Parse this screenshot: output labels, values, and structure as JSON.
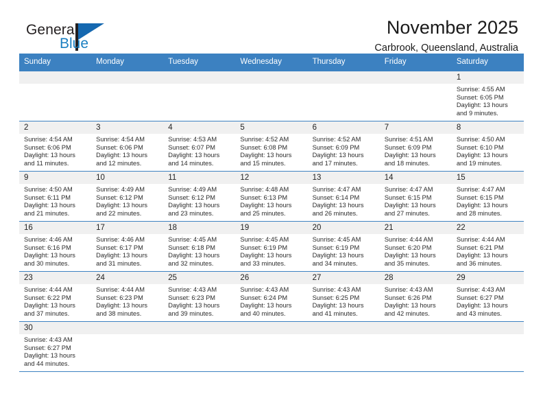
{
  "brand": {
    "name_top": "General",
    "name_bottom": "Blue",
    "accent_color": "#1a7fc1",
    "triangle_color": "#1568b0"
  },
  "header": {
    "month_title": "November 2025",
    "location": "Carbrook, Queensland, Australia"
  },
  "theme": {
    "header_blue": "#3c81c1",
    "daynum_bg": "#f0f0f0",
    "text": "#1a1a1a"
  },
  "weekday_headers": [
    "Sunday",
    "Monday",
    "Tuesday",
    "Wednesday",
    "Thursday",
    "Friday",
    "Saturday"
  ],
  "weeks": [
    [
      {
        "day": "",
        "sunrise": "",
        "sunset": "",
        "daylight_line1": "",
        "daylight_line2": ""
      },
      {
        "day": "",
        "sunrise": "",
        "sunset": "",
        "daylight_line1": "",
        "daylight_line2": ""
      },
      {
        "day": "",
        "sunrise": "",
        "sunset": "",
        "daylight_line1": "",
        "daylight_line2": ""
      },
      {
        "day": "",
        "sunrise": "",
        "sunset": "",
        "daylight_line1": "",
        "daylight_line2": ""
      },
      {
        "day": "",
        "sunrise": "",
        "sunset": "",
        "daylight_line1": "",
        "daylight_line2": ""
      },
      {
        "day": "",
        "sunrise": "",
        "sunset": "",
        "daylight_line1": "",
        "daylight_line2": ""
      },
      {
        "day": "1",
        "sunrise": "Sunrise: 4:55 AM",
        "sunset": "Sunset: 6:05 PM",
        "daylight_line1": "Daylight: 13 hours",
        "daylight_line2": "and 9 minutes."
      }
    ],
    [
      {
        "day": "2",
        "sunrise": "Sunrise: 4:54 AM",
        "sunset": "Sunset: 6:06 PM",
        "daylight_line1": "Daylight: 13 hours",
        "daylight_line2": "and 11 minutes."
      },
      {
        "day": "3",
        "sunrise": "Sunrise: 4:54 AM",
        "sunset": "Sunset: 6:06 PM",
        "daylight_line1": "Daylight: 13 hours",
        "daylight_line2": "and 12 minutes."
      },
      {
        "day": "4",
        "sunrise": "Sunrise: 4:53 AM",
        "sunset": "Sunset: 6:07 PM",
        "daylight_line1": "Daylight: 13 hours",
        "daylight_line2": "and 14 minutes."
      },
      {
        "day": "5",
        "sunrise": "Sunrise: 4:52 AM",
        "sunset": "Sunset: 6:08 PM",
        "daylight_line1": "Daylight: 13 hours",
        "daylight_line2": "and 15 minutes."
      },
      {
        "day": "6",
        "sunrise": "Sunrise: 4:52 AM",
        "sunset": "Sunset: 6:09 PM",
        "daylight_line1": "Daylight: 13 hours",
        "daylight_line2": "and 17 minutes."
      },
      {
        "day": "7",
        "sunrise": "Sunrise: 4:51 AM",
        "sunset": "Sunset: 6:09 PM",
        "daylight_line1": "Daylight: 13 hours",
        "daylight_line2": "and 18 minutes."
      },
      {
        "day": "8",
        "sunrise": "Sunrise: 4:50 AM",
        "sunset": "Sunset: 6:10 PM",
        "daylight_line1": "Daylight: 13 hours",
        "daylight_line2": "and 19 minutes."
      }
    ],
    [
      {
        "day": "9",
        "sunrise": "Sunrise: 4:50 AM",
        "sunset": "Sunset: 6:11 PM",
        "daylight_line1": "Daylight: 13 hours",
        "daylight_line2": "and 21 minutes."
      },
      {
        "day": "10",
        "sunrise": "Sunrise: 4:49 AM",
        "sunset": "Sunset: 6:12 PM",
        "daylight_line1": "Daylight: 13 hours",
        "daylight_line2": "and 22 minutes."
      },
      {
        "day": "11",
        "sunrise": "Sunrise: 4:49 AM",
        "sunset": "Sunset: 6:12 PM",
        "daylight_line1": "Daylight: 13 hours",
        "daylight_line2": "and 23 minutes."
      },
      {
        "day": "12",
        "sunrise": "Sunrise: 4:48 AM",
        "sunset": "Sunset: 6:13 PM",
        "daylight_line1": "Daylight: 13 hours",
        "daylight_line2": "and 25 minutes."
      },
      {
        "day": "13",
        "sunrise": "Sunrise: 4:47 AM",
        "sunset": "Sunset: 6:14 PM",
        "daylight_line1": "Daylight: 13 hours",
        "daylight_line2": "and 26 minutes."
      },
      {
        "day": "14",
        "sunrise": "Sunrise: 4:47 AM",
        "sunset": "Sunset: 6:15 PM",
        "daylight_line1": "Daylight: 13 hours",
        "daylight_line2": "and 27 minutes."
      },
      {
        "day": "15",
        "sunrise": "Sunrise: 4:47 AM",
        "sunset": "Sunset: 6:15 PM",
        "daylight_line1": "Daylight: 13 hours",
        "daylight_line2": "and 28 minutes."
      }
    ],
    [
      {
        "day": "16",
        "sunrise": "Sunrise: 4:46 AM",
        "sunset": "Sunset: 6:16 PM",
        "daylight_line1": "Daylight: 13 hours",
        "daylight_line2": "and 30 minutes."
      },
      {
        "day": "17",
        "sunrise": "Sunrise: 4:46 AM",
        "sunset": "Sunset: 6:17 PM",
        "daylight_line1": "Daylight: 13 hours",
        "daylight_line2": "and 31 minutes."
      },
      {
        "day": "18",
        "sunrise": "Sunrise: 4:45 AM",
        "sunset": "Sunset: 6:18 PM",
        "daylight_line1": "Daylight: 13 hours",
        "daylight_line2": "and 32 minutes."
      },
      {
        "day": "19",
        "sunrise": "Sunrise: 4:45 AM",
        "sunset": "Sunset: 6:19 PM",
        "daylight_line1": "Daylight: 13 hours",
        "daylight_line2": "and 33 minutes."
      },
      {
        "day": "20",
        "sunrise": "Sunrise: 4:45 AM",
        "sunset": "Sunset: 6:19 PM",
        "daylight_line1": "Daylight: 13 hours",
        "daylight_line2": "and 34 minutes."
      },
      {
        "day": "21",
        "sunrise": "Sunrise: 4:44 AM",
        "sunset": "Sunset: 6:20 PM",
        "daylight_line1": "Daylight: 13 hours",
        "daylight_line2": "and 35 minutes."
      },
      {
        "day": "22",
        "sunrise": "Sunrise: 4:44 AM",
        "sunset": "Sunset: 6:21 PM",
        "daylight_line1": "Daylight: 13 hours",
        "daylight_line2": "and 36 minutes."
      }
    ],
    [
      {
        "day": "23",
        "sunrise": "Sunrise: 4:44 AM",
        "sunset": "Sunset: 6:22 PM",
        "daylight_line1": "Daylight: 13 hours",
        "daylight_line2": "and 37 minutes."
      },
      {
        "day": "24",
        "sunrise": "Sunrise: 4:44 AM",
        "sunset": "Sunset: 6:23 PM",
        "daylight_line1": "Daylight: 13 hours",
        "daylight_line2": "and 38 minutes."
      },
      {
        "day": "25",
        "sunrise": "Sunrise: 4:43 AM",
        "sunset": "Sunset: 6:23 PM",
        "daylight_line1": "Daylight: 13 hours",
        "daylight_line2": "and 39 minutes."
      },
      {
        "day": "26",
        "sunrise": "Sunrise: 4:43 AM",
        "sunset": "Sunset: 6:24 PM",
        "daylight_line1": "Daylight: 13 hours",
        "daylight_line2": "and 40 minutes."
      },
      {
        "day": "27",
        "sunrise": "Sunrise: 4:43 AM",
        "sunset": "Sunset: 6:25 PM",
        "daylight_line1": "Daylight: 13 hours",
        "daylight_line2": "and 41 minutes."
      },
      {
        "day": "28",
        "sunrise": "Sunrise: 4:43 AM",
        "sunset": "Sunset: 6:26 PM",
        "daylight_line1": "Daylight: 13 hours",
        "daylight_line2": "and 42 minutes."
      },
      {
        "day": "29",
        "sunrise": "Sunrise: 4:43 AM",
        "sunset": "Sunset: 6:27 PM",
        "daylight_line1": "Daylight: 13 hours",
        "daylight_line2": "and 43 minutes."
      }
    ],
    [
      {
        "day": "30",
        "sunrise": "Sunrise: 4:43 AM",
        "sunset": "Sunset: 6:27 PM",
        "daylight_line1": "Daylight: 13 hours",
        "daylight_line2": "and 44 minutes."
      },
      {
        "day": "",
        "sunrise": "",
        "sunset": "",
        "daylight_line1": "",
        "daylight_line2": ""
      },
      {
        "day": "",
        "sunrise": "",
        "sunset": "",
        "daylight_line1": "",
        "daylight_line2": ""
      },
      {
        "day": "",
        "sunrise": "",
        "sunset": "",
        "daylight_line1": "",
        "daylight_line2": ""
      },
      {
        "day": "",
        "sunrise": "",
        "sunset": "",
        "daylight_line1": "",
        "daylight_line2": ""
      },
      {
        "day": "",
        "sunrise": "",
        "sunset": "",
        "daylight_line1": "",
        "daylight_line2": ""
      },
      {
        "day": "",
        "sunrise": "",
        "sunset": "",
        "daylight_line1": "",
        "daylight_line2": ""
      }
    ]
  ]
}
